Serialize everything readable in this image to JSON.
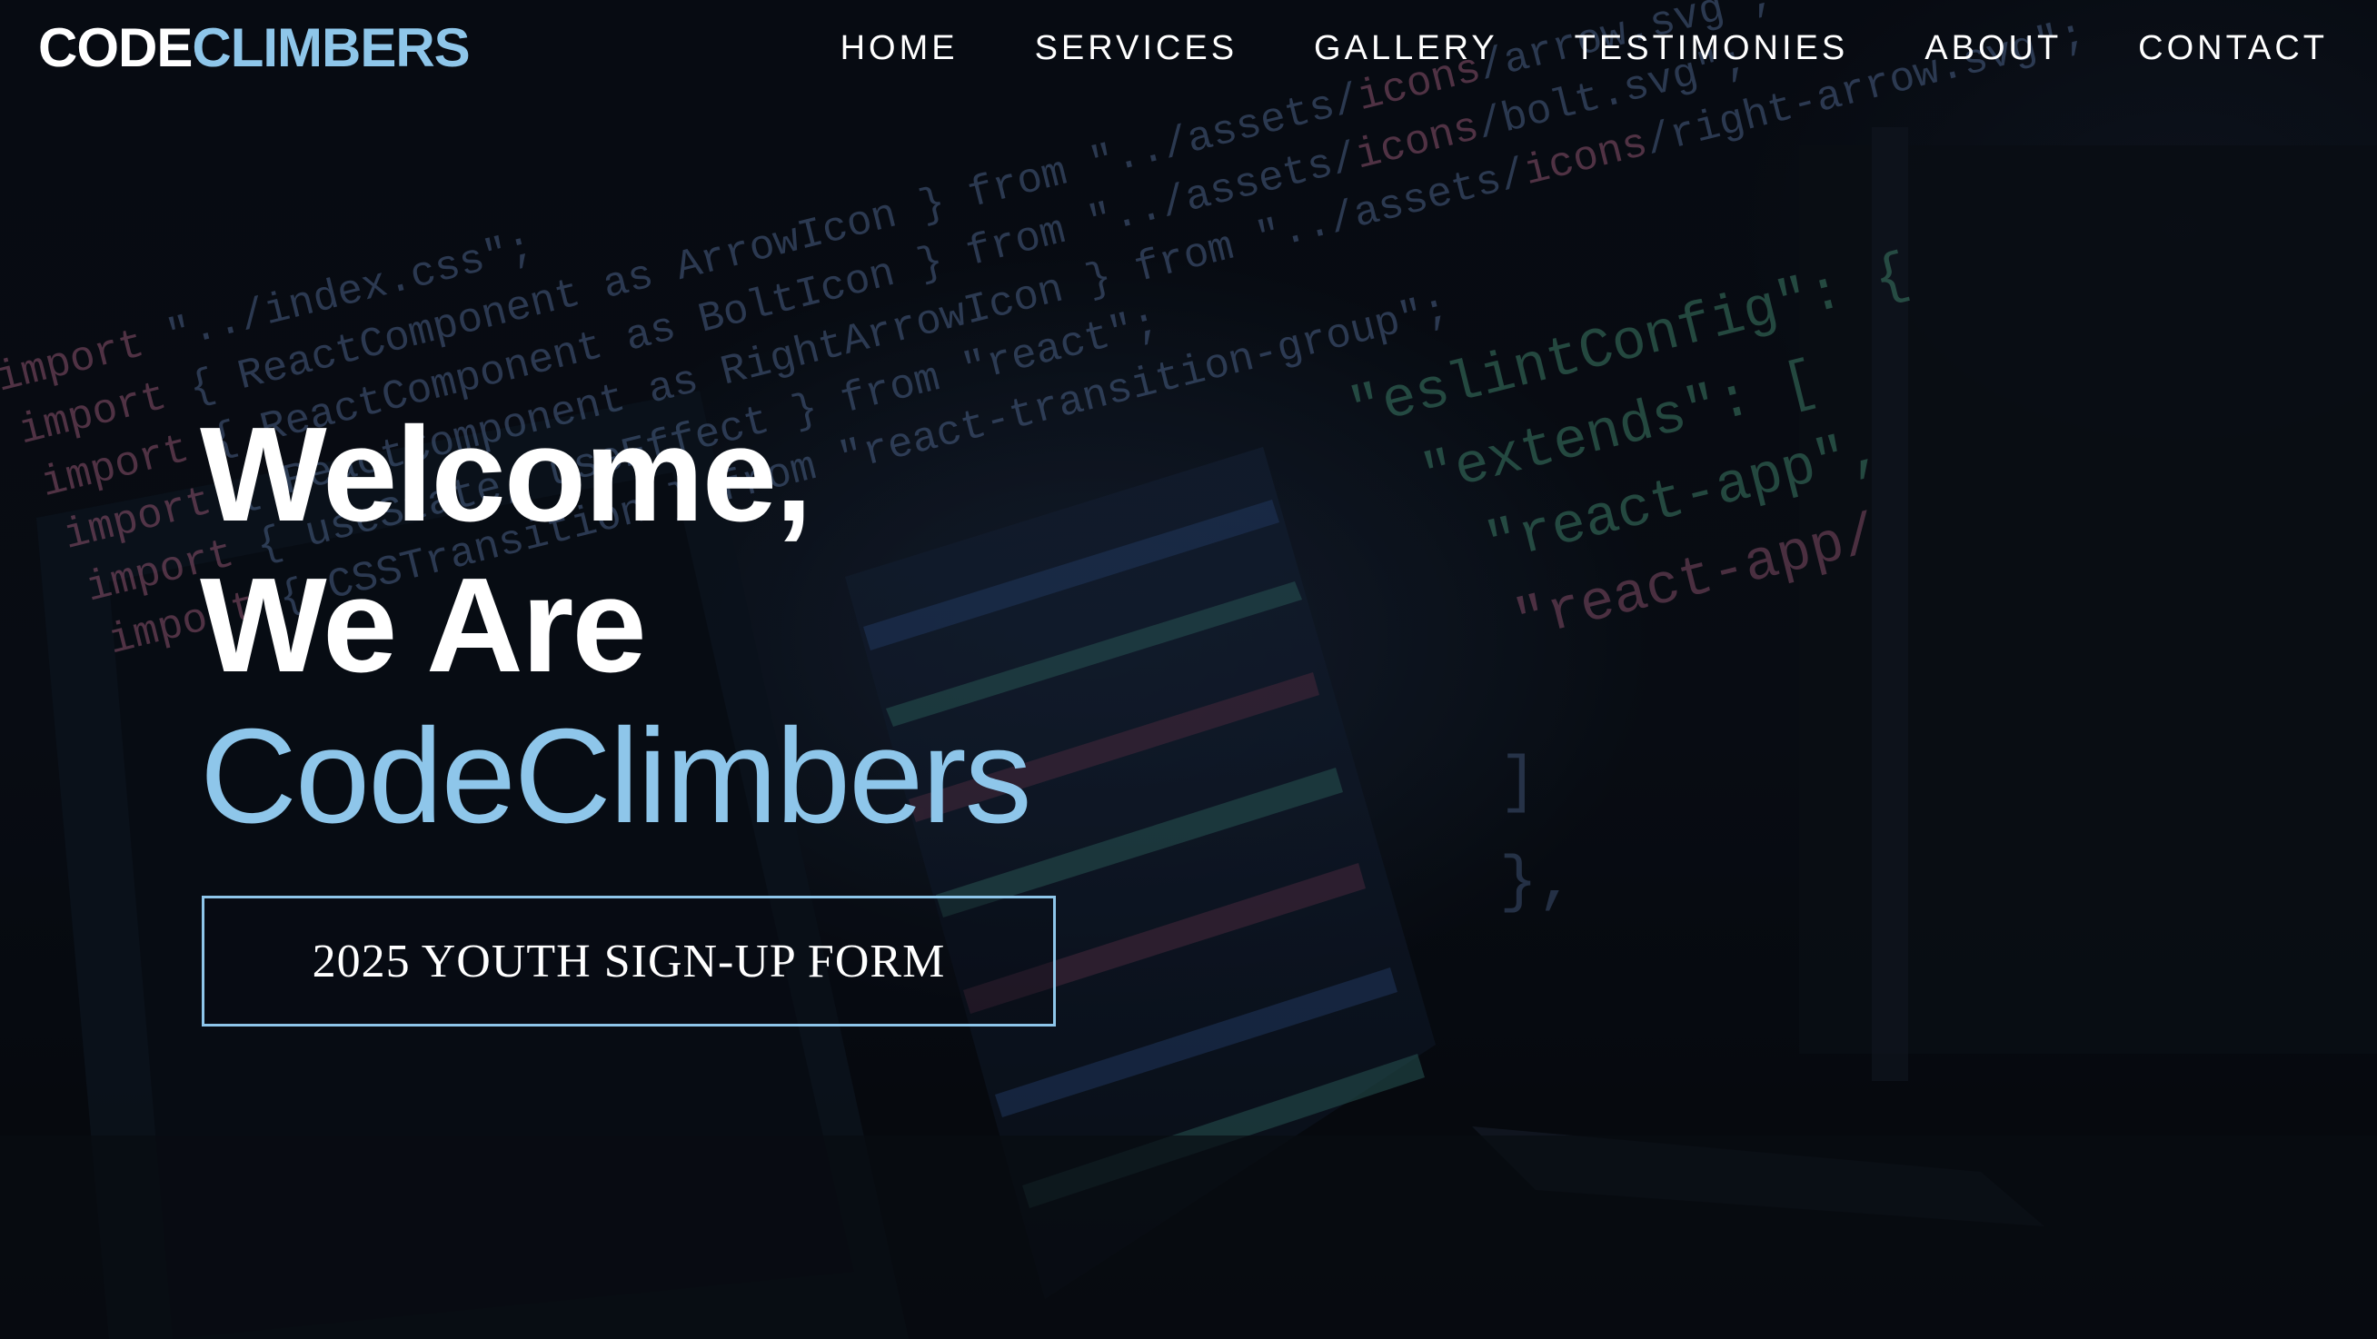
{
  "navbar": {
    "logo": {
      "part1": "CODE",
      "part2": "CLIMBERS"
    },
    "links": [
      {
        "label": "HOME"
      },
      {
        "label": "SERVICES"
      },
      {
        "label": "GALLERY"
      },
      {
        "label": "TESTIMONIES"
      },
      {
        "label": "ABOUT"
      },
      {
        "label": "CONTACT"
      }
    ]
  },
  "hero": {
    "line1": "Welcome,",
    "line2": "We Are",
    "line3": "CodeClimbers",
    "cta_label": "2025 YOUTH SIGN-UP FORM",
    "background_code_lines": [
      "import \"../index.css\";",
      "import { ReactComponent as ArrowIcon } from \"../assets/icons/arrow.svg\";",
      "import { ReactComponent as BoltIcon } from \"../assets/icons/bolt.svg\";",
      "import { ReactComponent as RightArrowIcon } from \"../assets/icons/right-arrow.svg\";",
      "import { useState, useEffect } from \"react\";",
      "import { CSSTransition } from \"react-transition-group\";"
    ],
    "background_config_lines": [
      "\"eslintConfig\": {",
      "\"extends\": [",
      "\"react-app\",",
      "\"react-app/",
      "]",
      "},"
    ]
  },
  "colors": {
    "accent": "#8ec6ea",
    "text": "#ffffff",
    "background": "#0a0e17",
    "code_pink": "#d77ba3",
    "code_green": "#62c9a2",
    "code_blue": "#6f8fc7"
  }
}
